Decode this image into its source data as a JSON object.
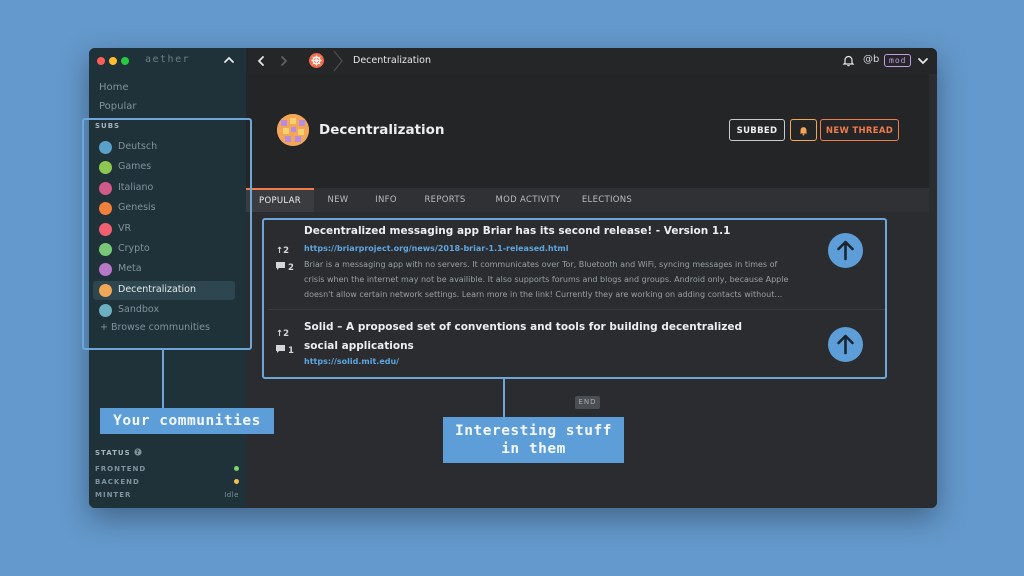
{
  "app": {
    "name": "aether"
  },
  "sidebar": {
    "nav": [
      {
        "label": "Home"
      },
      {
        "label": "Popular"
      }
    ],
    "subs_heading": "SUBS",
    "subs": [
      {
        "label": "Deutsch",
        "color": "#5aa0c8"
      },
      {
        "label": "Games",
        "color": "#8cc850"
      },
      {
        "label": "Italiano",
        "color": "#d05a8a"
      },
      {
        "label": "Genesis",
        "color": "#f0803c"
      },
      {
        "label": "VR",
        "color": "#f06070"
      },
      {
        "label": "Crypto",
        "color": "#78c878"
      },
      {
        "label": "Meta",
        "color": "#b878c8"
      },
      {
        "label": "Decentralization",
        "color": "#f2a657",
        "active": true
      },
      {
        "label": "Sandbox",
        "color": "#6ab0c0"
      }
    ],
    "browse_label": "+ Browse communities",
    "status": {
      "heading": "STATUS",
      "rows": [
        {
          "label": "FRONTEND",
          "color": "#7bd36b"
        },
        {
          "label": "BACKEND",
          "color": "#f2c14e"
        },
        {
          "label": "MINTER",
          "value": "Idle"
        }
      ]
    }
  },
  "topbar": {
    "breadcrumb": "Decentralization",
    "user": "@b",
    "badge": "mod"
  },
  "board": {
    "title": "Decentralization",
    "buttons": {
      "subbed": "SUBBED",
      "new_thread": "NEW THREAD"
    }
  },
  "tabs": [
    "POPULAR",
    "NEW",
    "INFO",
    "REPORTS",
    "MOD ACTIVITY",
    "ELECTIONS"
  ],
  "posts": [
    {
      "title": "Decentralized messaging app Briar has its second release! - Version 1.1",
      "link": "https://briarproject.org/news/2018-briar-1.1-released.html",
      "body": "Briar is a messaging app with no servers. It communicates over Tor, Bluetooth and WiFi, syncing messages in times of crisis when the internet may not be availible. It also supports forums and blogs and groups. Android only, because Apple doesn't allow certain network settings. Learn more in the link! Currently they are working on adding contacts without…",
      "votes": "2",
      "comments": "2"
    },
    {
      "title": "Solid – A proposed set of conventions and tools for building decentralized social applications",
      "link": "https://solid.mit.edu/",
      "votes": "2",
      "comments": "1"
    }
  ],
  "end_label": "END",
  "callouts": {
    "communities": "Your communities",
    "stuff_line1": "Interesting stuff",
    "stuff_line2": "in them"
  }
}
